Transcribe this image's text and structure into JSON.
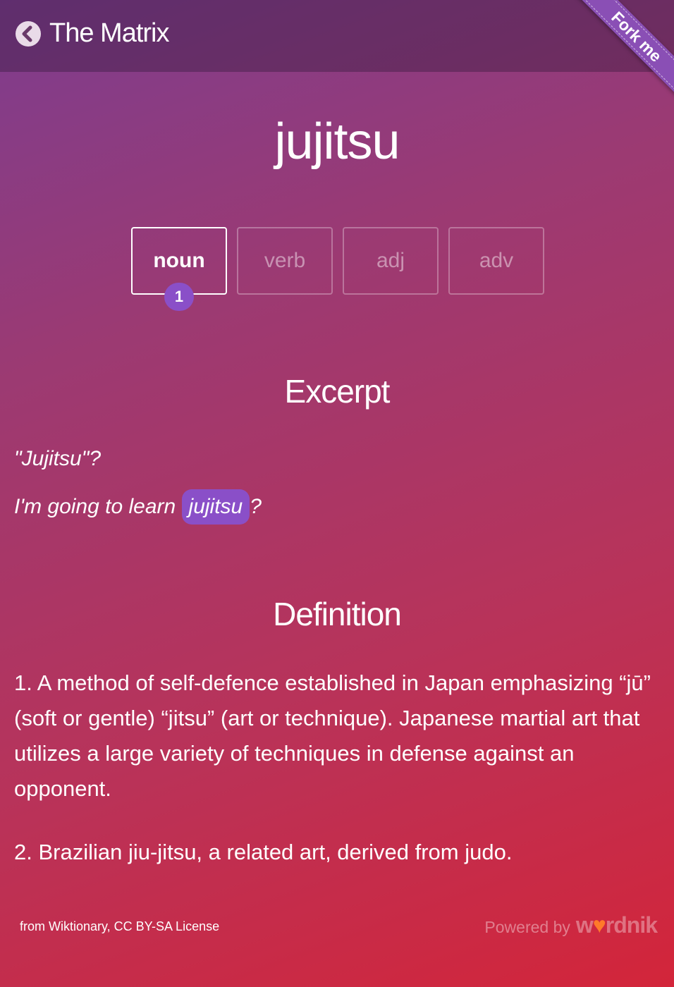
{
  "header": {
    "title": "The Matrix",
    "back_icon": "chevron-left-circle-icon"
  },
  "ribbon": {
    "label": "Fork me"
  },
  "word": "jujitsu",
  "pos_tabs": [
    {
      "label": "noun",
      "active": true,
      "count": "1"
    },
    {
      "label": "verb",
      "active": false
    },
    {
      "label": "adj",
      "active": false
    },
    {
      "label": "adv",
      "active": false
    }
  ],
  "excerpt": {
    "heading": "Excerpt",
    "line1": "\"Jujitsu\"?",
    "line2_before": "I'm going to learn ",
    "line2_highlight": "jujitsu",
    "line2_after": "?"
  },
  "definition": {
    "heading": "Definition",
    "items": [
      "1. A method of self-defence established in Japan emphasizing “jū” (soft or gentle) “jitsu” (art or technique). Japanese martial art that utilizes a large variety of techniques in defense against an opponent.",
      "2. Brazilian jiu-jitsu, a related art, derived from judo."
    ]
  },
  "footer": {
    "source": "from Wiktionary, CC BY-SA License",
    "powered_by": "Powered by",
    "logo_left": "w",
    "logo_right": "rdnik"
  },
  "colors": {
    "accent": "#8a4fc8",
    "ribbon": "#8a4fb5",
    "logo_heart": "#ff7a2a"
  }
}
